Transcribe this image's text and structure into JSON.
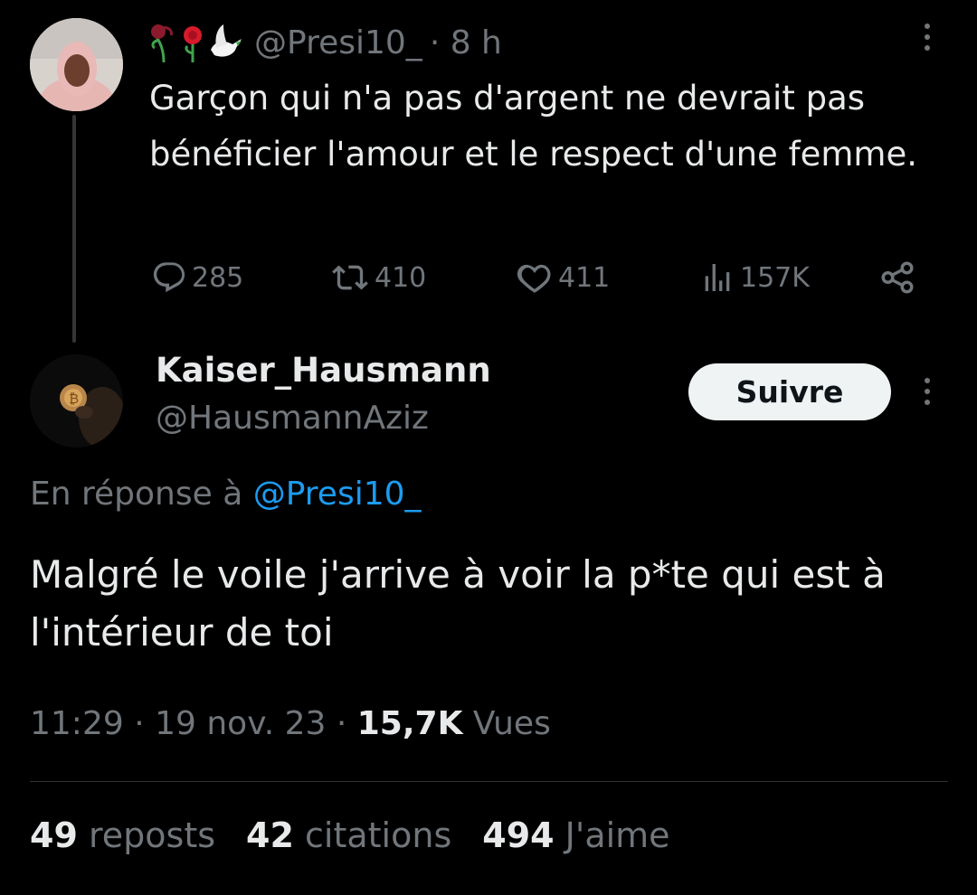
{
  "parent_tweet": {
    "emoji_icons": [
      "wilted-rose-icon",
      "rose-icon",
      "dove-icon"
    ],
    "handle": "@Presi10_",
    "time": "· 8 h",
    "text": "Garçon qui n'a pas d'argent ne devrait pas bénéficier l'amour et le respect d'une femme.",
    "actions": {
      "replies": "285",
      "reposts": "410",
      "likes": "411",
      "views": "157K"
    }
  },
  "reply_tweet": {
    "display_name": "Kaiser_Hausmann",
    "handle": "@HausmannAziz",
    "follow_label": "Suivre",
    "reply_prefix": "En réponse à",
    "reply_to": "@Presi10_",
    "text": "Malgré le voile j'arrive à voir la p*te qui est à l'intérieur de toi",
    "time": "11:29",
    "date": "19 nov. 23",
    "views_count": "15,7K",
    "views_label": "Vues",
    "stats": {
      "reposts_count": "49",
      "reposts_label": "reposts",
      "quotes_count": "42",
      "quotes_label": "citations",
      "likes_count": "494",
      "likes_label": "J'aime"
    }
  },
  "colors": {
    "background": "#000000",
    "text": "#e7e9ea",
    "muted": "#71767b",
    "link": "#1d9bf0",
    "divider": "#2f3336"
  }
}
